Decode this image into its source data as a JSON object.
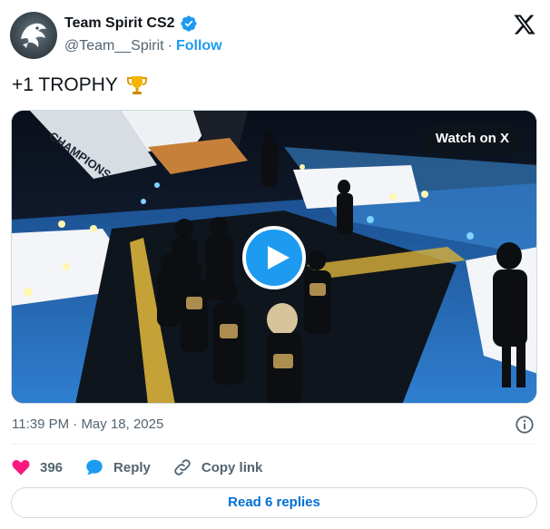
{
  "author": {
    "display_name": "Team Spirit CS2",
    "handle": "@Team__Spirit",
    "separator": "·",
    "follow_label": "Follow"
  },
  "tweet": {
    "text": "+1 TROPHY",
    "emoji": "trophy-icon"
  },
  "media": {
    "watch_label": "Watch on X",
    "banner_text": "CHAMPIONS"
  },
  "meta": {
    "time": "11:39 PM",
    "separator": "·",
    "date": "May 18, 2025"
  },
  "actions": {
    "likes_count": "396",
    "reply_label": "Reply",
    "copy_link_label": "Copy link"
  },
  "read_replies_label": "Read 6 replies",
  "colors": {
    "accent": "#1d9bf0",
    "like": "#f91880",
    "text_primary": "#0f1419",
    "text_secondary": "#536471",
    "link": "#006fd6"
  }
}
